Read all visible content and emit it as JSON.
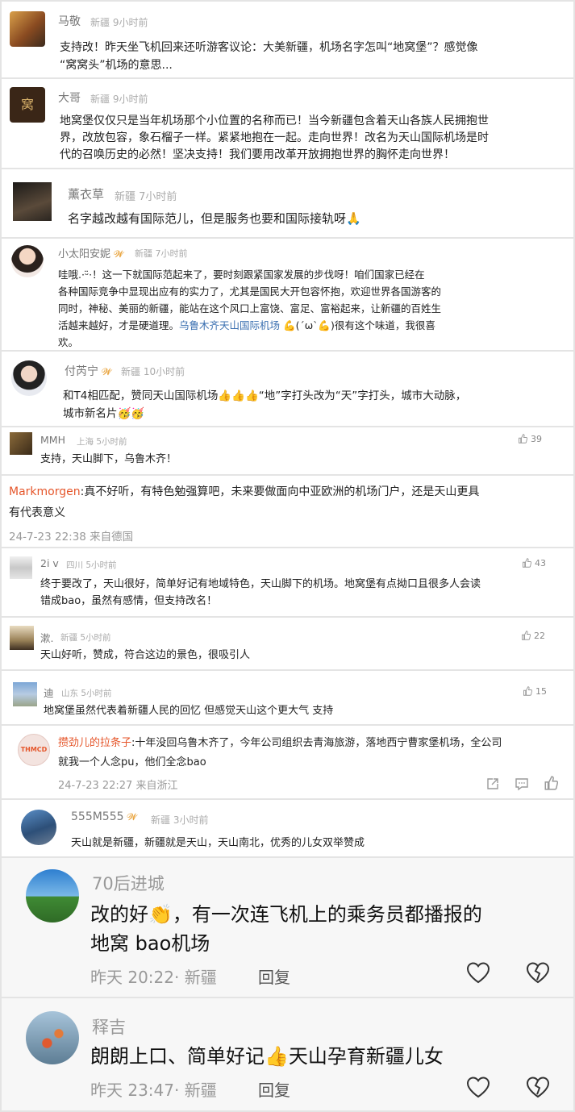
{
  "comments": [
    {
      "name": "马敬",
      "location": "新疆",
      "time": "9小时前",
      "text": "支持改！昨天坐飞机回来还听游客议论：大美新疆，机场名字怎叫“地窝堡”？感觉像\n“窝窝头”机场的意思..."
    },
    {
      "name": "大哥",
      "location": "新疆",
      "time": "9小时前",
      "text": "地窝堡仅仅只是当年机场那个小位置的名称而已！当今新疆包含着天山各族人民拥抱世\n界，改放包容，象石榴子一样。紧紧地抱在一起。走向世界！改名为天山国际机场是时\n代的召唤历史的必然！坚决支持！我们要用改革开放拥抱世界的胸怀走向世界！"
    },
    {
      "name": "薰衣草",
      "location": "新疆",
      "time": "7小时前",
      "text": "名字越改越有国际范儿，但是服务也要和国际接轨呀🙏"
    },
    {
      "name": "小太阳安妮",
      "badge": "𝓦",
      "location": "新疆",
      "time": "7小时前",
      "text_before": "哇哦.·ᵕ̈·！这一下就国际范起来了，要时刻跟紧国家发展的步伐呀！咱们国家已经在\n各种国际竞争中显现出应有的实力了，尤其是国民大开包容怀抱，欢迎世界各国游客的\n同时，神秘、美丽的新疆，能站在这个风口上富饶、富足、富裕起来，让新疆的百姓生\n活越来越好，才是硬道理。",
      "link": "乌鲁木齐天山国际机场",
      "text_after": " 💪(ˊωˋ💪)很有这个味道，我很喜\n欢。"
    },
    {
      "name": "付芮宁",
      "badge": "𝓦",
      "location": "新疆",
      "time": "10小时前",
      "text": "和T4相匹配，赞同天山国际机场👍👍👍“地”字打头改为“天”字打头，城市大动脉，\n城市新名片🥳🥳"
    },
    {
      "name": "MMH",
      "location": "上海",
      "time": "5小时前",
      "likes": "39",
      "text": "支持，天山脚下，乌鲁木齐！"
    },
    {
      "name": "Markmorgen",
      "text": "真不好听，有特色勉强算吧，未来要做面向中亚欧洲的机场门户，还是天山更具\n有代表意义",
      "meta": "24-7-23 22:38 来自德国"
    },
    {
      "name": "2i v",
      "location": "四川",
      "time": "5小时前",
      "likes": "43",
      "text": "终于要改了，天山很好，简单好记有地域特色，天山脚下的机场。地窝堡有点拗口且很多人会读\n错成bao，虽然有感情，但支持改名！"
    },
    {
      "name": "漱.",
      "location": "新疆",
      "time": "5小时前",
      "likes": "22",
      "text": "天山好听，赞成，符合这边的景色，很吸引人"
    },
    {
      "name": "迪",
      "location": "山东",
      "time": "5小时前",
      "likes": "15",
      "text": "地窝堡虽然代表着新疆人民的回忆 但感觉天山这个更大气 支持"
    },
    {
      "name": "攒劲儿的拉条子",
      "text": "十年没回乌鲁木齐了，今年公司组织去青海旅游，落地西宁曹家堡机场，全公司\n就我一个人念pu，他们全念bao",
      "meta": "24-7-23 22:27 来自浙江",
      "avatar_text": "THMCD"
    },
    {
      "name": "555M555",
      "badge": "𝓦",
      "location": "新疆",
      "time": "3小时前",
      "text": "天山就是新疆，新疆就是天山，天山南北，优秀的儿女双举赞成"
    },
    {
      "name": "70后进城",
      "text": "改的好👏，有一次连飞机上的乘务员都播报的\n地窝 bao机场",
      "meta": "昨天 20:22· 新疆",
      "reply": "回复"
    },
    {
      "name": "释吉",
      "text": "朗朗上口、简单好记👍天山孕育新疆儿女",
      "meta": "昨天 23:47· 新疆",
      "reply": "回复"
    }
  ],
  "colors": {
    "name_gray": "#777",
    "name_orange": "#e5562b",
    "link_blue": "#3a6fb0",
    "badge": "#e8a23a",
    "meta": "#aaa"
  },
  "icons": [
    "thumb-up-icon",
    "share-icon",
    "comment-icon",
    "heart-icon",
    "dislike-heart-icon"
  ]
}
